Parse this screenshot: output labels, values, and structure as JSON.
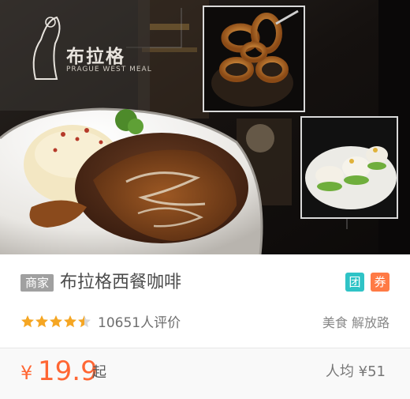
{
  "hero": {
    "brand_name": "布拉格",
    "brand_subtitle": "PRAGUE WEST MEAL"
  },
  "shop": {
    "merchant_badge": "商家",
    "name": "布拉格西餐咖啡",
    "tags": {
      "tuan": "团",
      "quan": "券"
    },
    "rating": 4.5,
    "review_count": "10651人评价",
    "category": "美食 解放路"
  },
  "price": {
    "currency": "¥",
    "value": "19.9",
    "suffix": "起",
    "avg_price": "人均 ¥51"
  },
  "colors": {
    "accent": "#ff6633",
    "tuan_tag": "#2fc3c6",
    "quan_tag": "#ff7a45",
    "star_active": "#f5a623",
    "star_inactive": "#d8d8d8",
    "merchant_badge": "#a0a0a0"
  }
}
